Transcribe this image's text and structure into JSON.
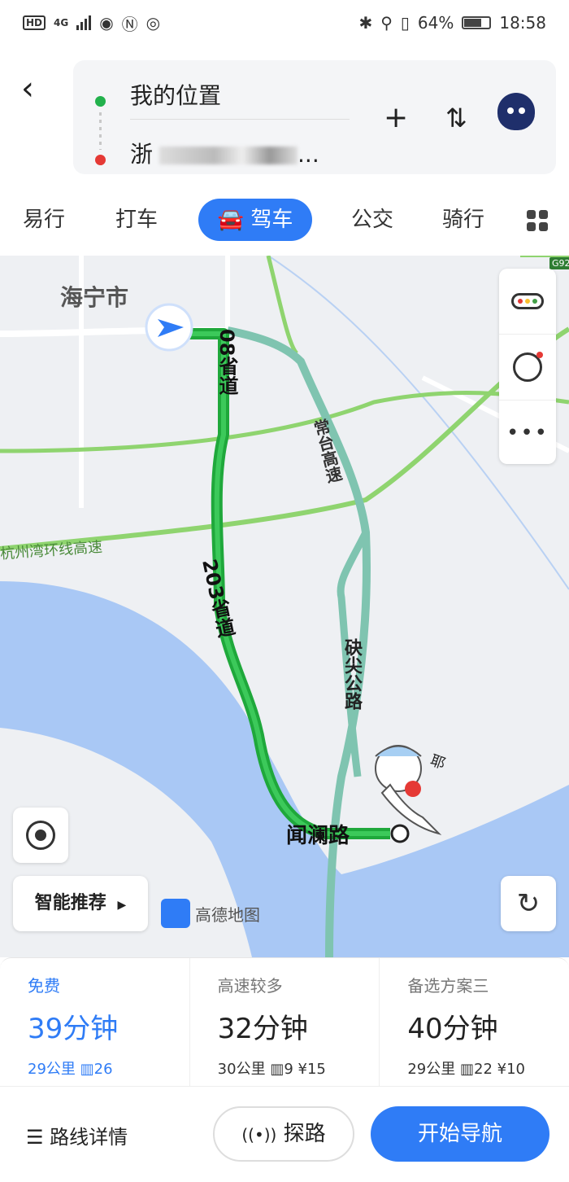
{
  "status_bar": {
    "left_text": "HD",
    "network": "4G",
    "battery_percent": "64%",
    "time": "18:58"
  },
  "route": {
    "from": "我的位置",
    "to": "浙江...",
    "to_visible_prefix": "浙",
    "to_visible_suffix": "..."
  },
  "header": {
    "back_icon": "chevron-left-icon",
    "add_icon": "plus-icon",
    "swap_icon": "swap-icon"
  },
  "tabs": [
    {
      "label": "易行"
    },
    {
      "label": "打车"
    },
    {
      "label": "驾车"
    },
    {
      "label": "公交"
    },
    {
      "label": "骑行"
    }
  ],
  "map": {
    "city_label": "海宁市",
    "road_labels": [
      "杭州湾环线高速",
      "常台高速",
      "砄尖公路",
      "闻澜路"
    ],
    "route_labels": [
      "08省道",
      "203省道"
    ],
    "amap_logo_text": "高德地图",
    "smart_recommend": "智能推荐",
    "highway_shield": "G92",
    "mascot_text": "耶"
  },
  "side_panel": {
    "items": [
      "traffic-toggle-icon",
      "history-icon",
      "more-icon"
    ]
  },
  "options": [
    {
      "label": "免费",
      "time": "39分钟",
      "distance": "29公里",
      "lights": "26",
      "toll": ""
    },
    {
      "label": "高速较多",
      "time": "32分钟",
      "distance": "30公里",
      "lights": "9",
      "toll": "¥15"
    },
    {
      "label": "备选方案三",
      "time": "40分钟",
      "distance": "29公里",
      "lights": "22",
      "toll": "¥10"
    }
  ],
  "bottom": {
    "detail": "路线详情",
    "explore": "探路",
    "start": "开始导航"
  },
  "colors": {
    "accent": "#2f7cf6",
    "route_green": "#1fa83b",
    "water": "#a9c8f5"
  }
}
